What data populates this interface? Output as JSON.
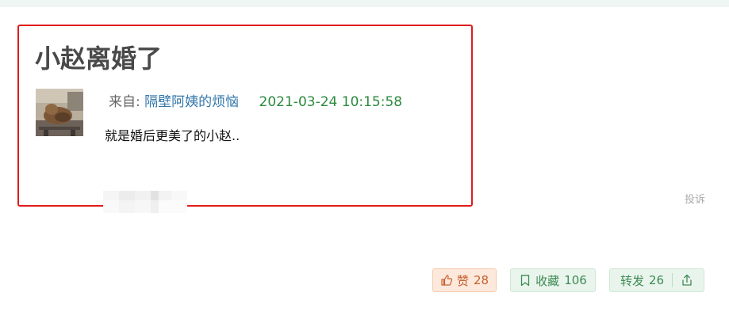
{
  "post": {
    "title": "小赵离婚了",
    "from_label": "来自:",
    "author": "隔壁阿姨的烦恼",
    "timestamp": "2021-03-24 10:15:58",
    "body": "就是婚后更美了的小赵.."
  },
  "footer": {
    "report_label": "投诉"
  },
  "actions": {
    "like_label": "赞",
    "like_count": "28",
    "favorite_label": "收藏",
    "favorite_count": "106",
    "share_label": "转发",
    "share_count": "26"
  },
  "colors": {
    "highlight_border": "#e01b1b",
    "author_link": "#3377aa",
    "timestamp": "#2b8a3e",
    "like_bg": "#fde8dc",
    "like_text": "#c7612e",
    "green_bg": "#e9f5ec",
    "green_text": "#3e8a55"
  },
  "icons": {
    "like": "thumbs-up-icon",
    "favorite": "bookmark-icon",
    "share": "share-icon"
  }
}
